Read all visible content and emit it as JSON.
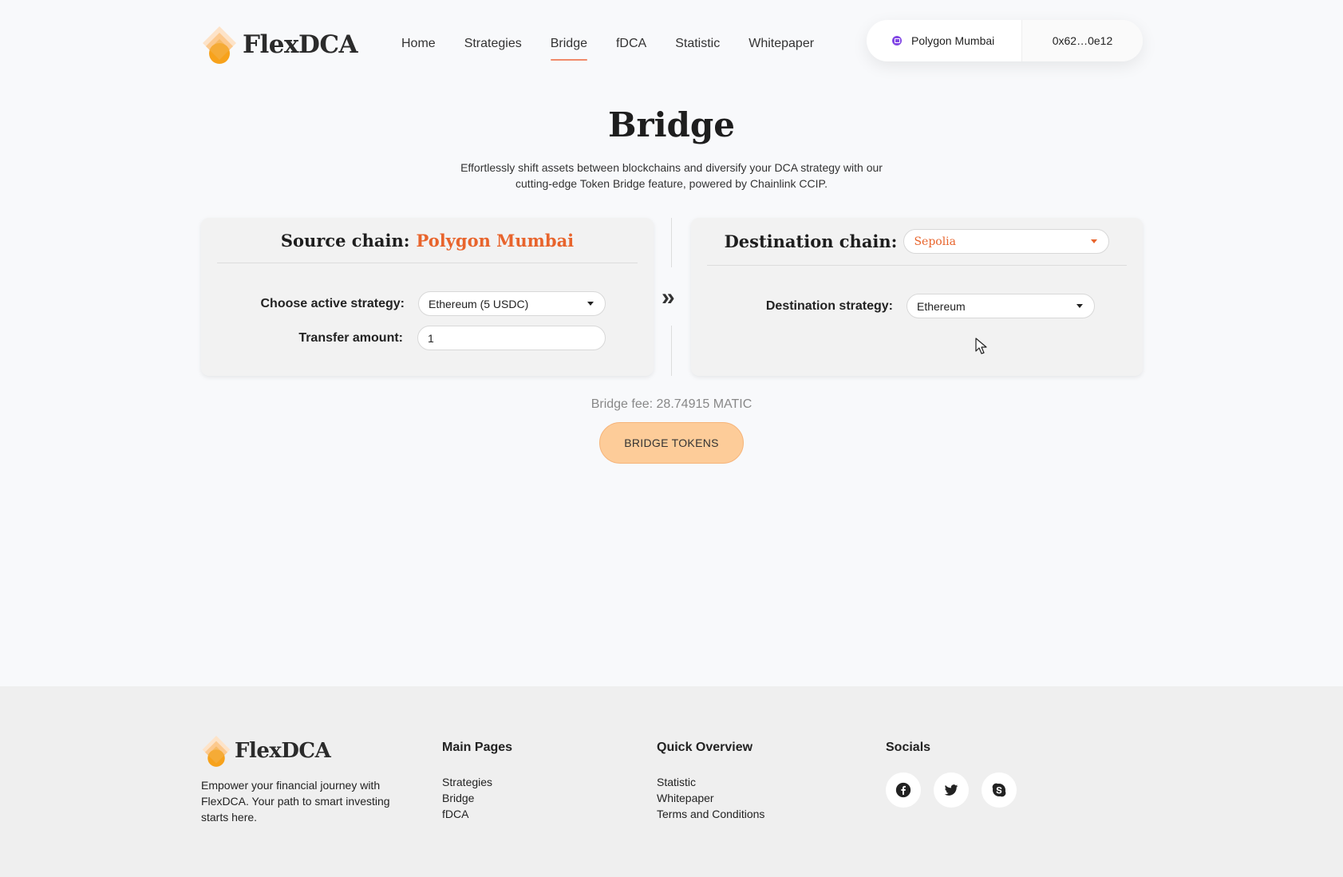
{
  "header": {
    "logo_text": "FlexDCA",
    "nav": [
      {
        "label": "Home",
        "active": false
      },
      {
        "label": "Strategies",
        "active": false
      },
      {
        "label": "Bridge",
        "active": true
      },
      {
        "label": "fDCA",
        "active": false
      },
      {
        "label": "Statistic",
        "active": false
      },
      {
        "label": "Whitepaper",
        "active": false
      }
    ],
    "wallet": {
      "network": "Polygon Mumbai",
      "address": "0x62…0e12",
      "network_color": "#8247e5"
    }
  },
  "main": {
    "title": "Bridge",
    "subtitle": "Effortlessly shift assets between blockchains and diversify your DCA strategy with our cutting-edge Token Bridge feature, powered by Chainlink CCIP.",
    "source": {
      "label": "Source chain:",
      "chain": "Polygon Mumbai",
      "strategy_label": "Choose active strategy:",
      "strategy_value": "Ethereum (5 USDC)",
      "amount_label": "Transfer amount:",
      "amount_value": "1"
    },
    "arrow": "»",
    "destination": {
      "label": "Destination chain:",
      "chain": "Sepolia",
      "strategy_label": "Destination strategy:",
      "strategy_value": "Ethereum"
    },
    "fee": "Bridge fee: 28.74915 MATIC",
    "bridge_button": "BRIDGE TOKENS"
  },
  "footer": {
    "logo_text": "FlexDCA",
    "description": "Empower your financial journey with FlexDCA. Your path to smart investing starts here.",
    "main_pages": {
      "title": "Main Pages",
      "links": [
        "Strategies",
        "Bridge",
        "fDCA"
      ]
    },
    "quick_overview": {
      "title": "Quick Overview",
      "links": [
        "Statistic",
        "Whitepaper",
        "Terms and Conditions"
      ]
    },
    "socials": {
      "title": "Socials",
      "icons": [
        "facebook-icon",
        "twitter-icon",
        "skype-icon"
      ]
    }
  },
  "colors": {
    "accent_orange": "#e8642c",
    "button_fill": "#fdcc99",
    "nav_underline": "#f08a6a"
  }
}
